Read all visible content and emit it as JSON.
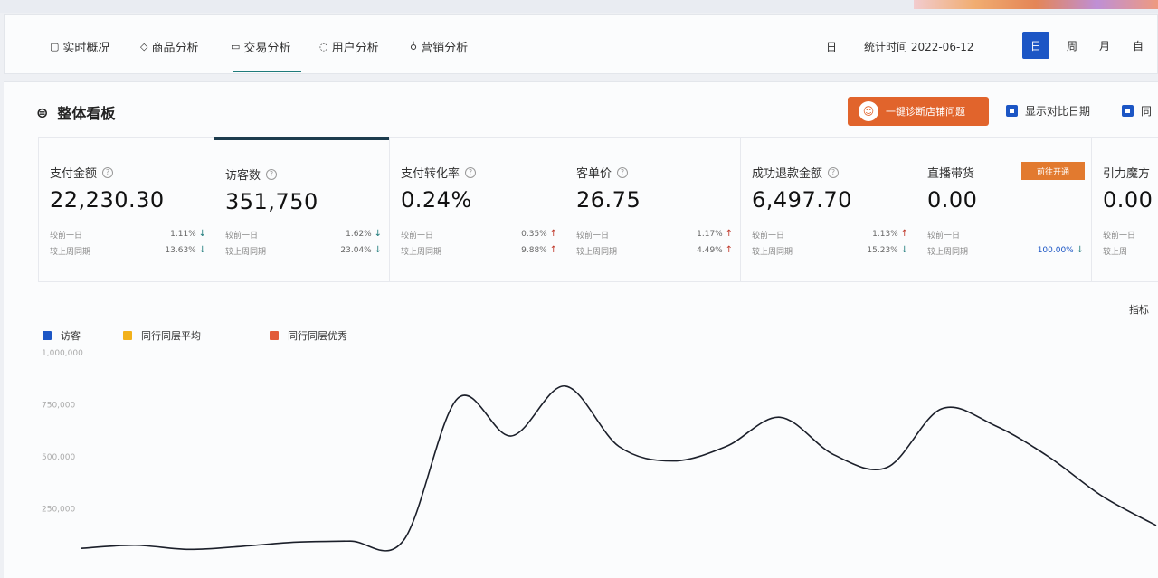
{
  "navbar": {
    "tabs": [
      {
        "label": "实时概况",
        "icon": "monitor-icon"
      },
      {
        "label": "商品分析",
        "icon": "box-icon"
      },
      {
        "label": "交易分析",
        "icon": "chart-icon"
      },
      {
        "label": "用户分析",
        "icon": "user-icon"
      },
      {
        "label": "营销分析",
        "icon": "tag-icon"
      }
    ],
    "active_tab_index": 2,
    "date_icon_label": "日",
    "date_text": "统计时间 2022-06-12",
    "segments": [
      {
        "label": "日",
        "active": true
      },
      {
        "label": "周",
        "active": false
      },
      {
        "label": "月",
        "active": false
      },
      {
        "label": "自",
        "active": false
      }
    ]
  },
  "panel": {
    "title": "整体看板",
    "orange_button_label": "一键诊断店铺问题",
    "checkbox_1_label": "显示对比日期",
    "checkbox_2_label": "同"
  },
  "metrics": [
    {
      "label": "支付金额",
      "value": "22,230.30",
      "row1_label": "较前一日",
      "row1_pct": "1.11%",
      "row1_dir": "down",
      "row2_label": "较上周同期",
      "row2_pct": "13.63%",
      "row2_dir": "down"
    },
    {
      "label": "访客数",
      "value": "351,750",
      "row1_label": "较前一日",
      "row1_pct": "1.62%",
      "row1_dir": "down",
      "row2_label": "较上周同期",
      "row2_pct": "23.04%",
      "row2_dir": "down"
    },
    {
      "label": "支付转化率",
      "value": "0.24%",
      "row1_label": "较前一日",
      "row1_pct": "0.35%",
      "row1_dir": "up",
      "row2_label": "较上周同期",
      "row2_pct": "9.88%",
      "row2_dir": "up"
    },
    {
      "label": "客单价",
      "value": "26.75",
      "row1_label": "较前一日",
      "row1_pct": "1.17%",
      "row1_dir": "up",
      "row2_label": "较上周同期",
      "row2_pct": "4.49%",
      "row2_dir": "up"
    },
    {
      "label": "成功退款金额",
      "value": "6,497.70",
      "row1_label": "较前一日",
      "row1_pct": "1.13%",
      "row1_dir": "up",
      "row2_label": "较上周同期",
      "row2_pct": "15.23%",
      "row2_dir": "down"
    },
    {
      "label": "直播带货",
      "value": "0.00",
      "tag": "前往开通",
      "row1_label": "较前一日",
      "row1_pct": "",
      "row1_dir": "",
      "row2_label": "较上周同期",
      "row2_pct": "100.00%",
      "row2_dir": "down"
    },
    {
      "label": "引力魔方",
      "value": "0.00",
      "row1_label": "较前一日",
      "row1_pct": "",
      "row1_dir": "",
      "row2_label": "较上周",
      "row2_pct": "",
      "row2_dir": ""
    }
  ],
  "legend": [
    {
      "label": "访客",
      "color": "#1c56c5"
    },
    {
      "label": "同行同层平均",
      "color": "#f2b11b"
    },
    {
      "label": "同行同层优秀",
      "color": "#e25b3a"
    }
  ],
  "corner_text": "指标",
  "chart_data": {
    "type": "line",
    "yticks": [
      "1,000,000",
      "750,000",
      "500,000",
      "250,000"
    ],
    "series": [
      {
        "values": [
          60000,
          75000,
          55000,
          70000,
          90000,
          95000,
          100000,
          780000,
          600000,
          840000,
          550000,
          480000,
          550000,
          690000,
          510000,
          450000,
          730000,
          650000,
          500000,
          310000,
          170000
        ]
      }
    ]
  }
}
